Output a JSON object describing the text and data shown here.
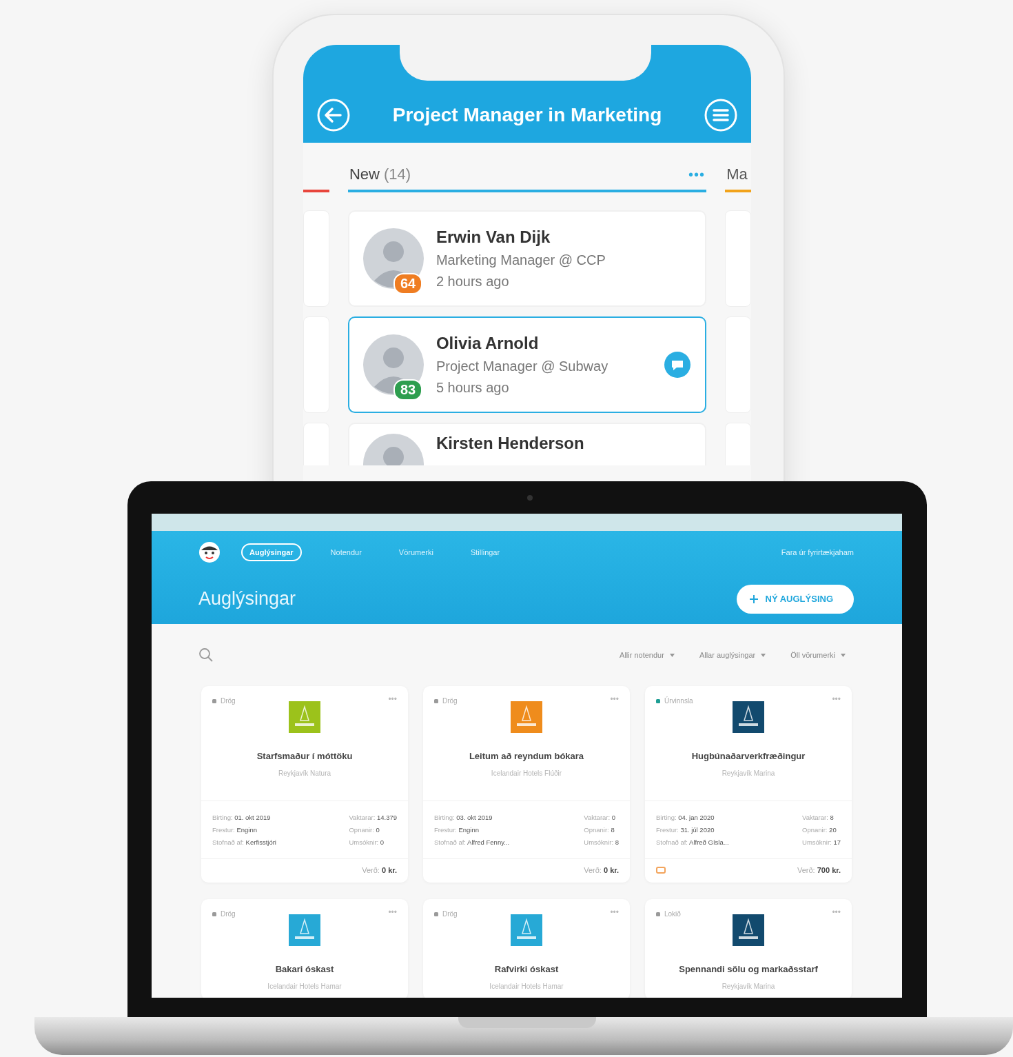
{
  "phone": {
    "title": "Project Manager in Marketing",
    "columns": [
      {
        "color": "#e8453c",
        "selected": false
      },
      {
        "label": "New",
        "count": "(14)",
        "color": "#2aaee2",
        "selected": true
      },
      {
        "label": "Ma",
        "color": "#f2a31b",
        "selected": false
      }
    ],
    "more": "•••",
    "candidates": [
      {
        "name": "Erwin Van Dijk",
        "role": "Marketing Manager @ CCP",
        "time": "2 hours ago",
        "score": "64",
        "color": "#ef7d22",
        "selected": false,
        "has_message": false
      },
      {
        "name": "Olivia Arnold",
        "role": "Project Manager @ Subway",
        "time": "5 hours ago",
        "score": "83",
        "color": "#2e9e4f",
        "selected": true,
        "has_message": true
      },
      {
        "name": "Kirsten Henderson",
        "selected": false,
        "has_message": false
      }
    ]
  },
  "laptop": {
    "nav": [
      {
        "label": "Auglýsingar",
        "selected": true
      },
      {
        "label": "Notendur",
        "selected": false
      },
      {
        "label": "Vörumerki",
        "selected": false
      },
      {
        "label": "Stillingar",
        "selected": false
      }
    ],
    "exit_link": "Fara úr fyrirtækjaham",
    "page_title": "Auglýsingar",
    "new_button": "NÝ AUGLÝSING",
    "filters": [
      "Allir notendur",
      "Allar auglýsingar",
      "Öll vörumerki"
    ],
    "ads": [
      {
        "status": "Drög",
        "color": "#9a9a9a",
        "menu": "•••",
        "logo": {
          "color": "#9cc21b"
        },
        "title": "Starfsmaður í móttöku",
        "company": "Reykjavík Natura",
        "details_left": [
          {
            "label": "Birting:",
            "value": "01. okt 2019"
          },
          {
            "label": "Frestur:",
            "value": "Enginn"
          },
          {
            "label": "Stofnað af:",
            "value": "Kerfisstjóri"
          }
        ],
        "details_right": [
          {
            "label": "Vaktarar:",
            "value": "14.379"
          },
          {
            "label": "Opnanir:",
            "value": "0"
          },
          {
            "label": "Umsóknir:",
            "value": "0"
          }
        ],
        "price_label": "Verð:",
        "price": "0 kr.",
        "has_tag": false
      },
      {
        "status": "Drög",
        "color": "#9a9a9a",
        "menu": "•••",
        "logo": {
          "color": "#ef8c1c"
        },
        "title": "Leitum að reyndum bókara",
        "company": "Icelandair Hotels Flúðir",
        "details_left": [
          {
            "label": "Birting:",
            "value": "03. okt 2019"
          },
          {
            "label": "Frestur:",
            "value": "Enginn"
          },
          {
            "label": "Stofnað af:",
            "value": "Alfred Fenny..."
          }
        ],
        "details_right": [
          {
            "label": "Vaktarar:",
            "value": "0"
          },
          {
            "label": "Opnanir:",
            "value": "8"
          },
          {
            "label": "Umsóknir:",
            "value": "8"
          }
        ],
        "price_label": "Verð:",
        "price": "0 kr.",
        "has_tag": false
      },
      {
        "status": "Úrvinnsla",
        "color": "#1e9e94",
        "menu": "•••",
        "logo": {
          "color": "#124a6e"
        },
        "title": "Hugbúnaðarverkfræðingur",
        "company": "Reykjavík Marina",
        "details_left": [
          {
            "label": "Birting:",
            "value": "04. jan 2020"
          },
          {
            "label": "Frestur:",
            "value": "31. júl 2020"
          },
          {
            "label": "Stofnað af:",
            "value": "Alfreð Gísla..."
          }
        ],
        "details_right": [
          {
            "label": "Vaktarar:",
            "value": "8"
          },
          {
            "label": "Opnanir:",
            "value": "20"
          },
          {
            "label": "Umsóknir:",
            "value": "17"
          }
        ],
        "price_label": "Verð:",
        "price": "700 kr.",
        "has_tag": true
      },
      {
        "status": "Drög",
        "color": "#9a9a9a",
        "menu": "•••",
        "logo": {
          "color": "#27a9d6"
        },
        "title": "Bakari óskast",
        "company": "Icelandair Hotels Hamar"
      },
      {
        "status": "Drög",
        "color": "#9a9a9a",
        "menu": "•••",
        "logo": {
          "color": "#27a9d6"
        },
        "title": "Rafvirki óskast",
        "company": "Icelandair Hotels Hamar"
      },
      {
        "status": "Lokið",
        "color": "#9a9a9a",
        "menu": "•••",
        "logo": {
          "color": "#124a6e"
        },
        "title": "Spennandi sölu og markaðsstarf",
        "company": "Reykjavík Marina"
      }
    ]
  }
}
